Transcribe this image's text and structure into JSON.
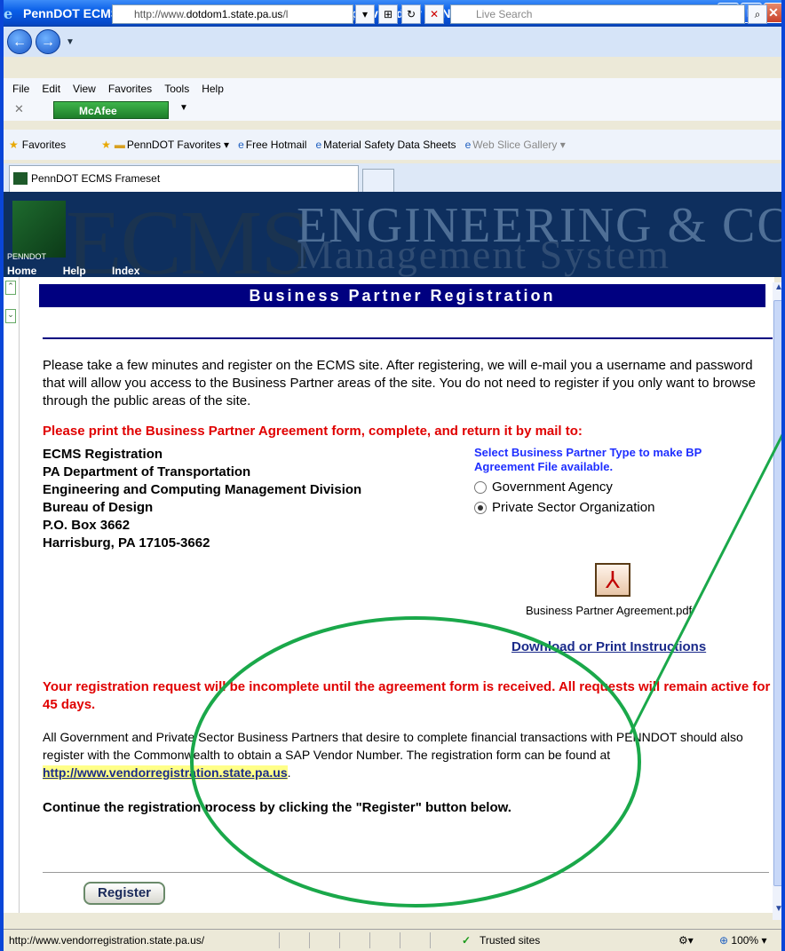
{
  "window": {
    "title": "PennDOT ECMS Frameset - Microsoft Internet Explorer provided by PENNDOT"
  },
  "address": {
    "url": "http://www.dotdom1.state.pa.us/l",
    "url_prefix": "http://www.",
    "url_host": "dotdom1.state.pa.us",
    "url_tail": "/l",
    "search_placeholder": "Live Search"
  },
  "menu": [
    "File",
    "Edit",
    "View",
    "Favorites",
    "Tools",
    "Help"
  ],
  "toolbar": {
    "mcafee": "McAfee"
  },
  "favorites": {
    "label": "Favorites",
    "items": [
      "PennDOT Favorites ▾",
      "Free Hotmail",
      "Material Safety Data Sheets",
      "Web Slice Gallery ▾"
    ]
  },
  "tab": {
    "title": "PennDOT ECMS Frameset"
  },
  "banner": {
    "logo_text": "ECMS",
    "line1": "ENGINEERING & CONSTRUC",
    "line2": "Management   System",
    "brand": "PENNDOT",
    "nav": [
      "Home",
      "Help",
      "Index"
    ]
  },
  "page": {
    "heading": "Business Partner Registration",
    "intro": "Please take a few minutes and register on the ECMS site. After registering, we will e-mail you a username and password that will allow you access to the Business Partner areas of the site. You do not need to register if you only want to browse through the public areas of the site.",
    "print_notice": "Please print the Business Partner Agreement form, complete, and return it by mail to:",
    "address_lines": [
      "ECMS Registration",
      "PA Department of Transportation",
      "Engineering and Computing Management Division",
      "Bureau of Design",
      "P.O. Box 3662",
      "Harrisburg, PA 17105-3662"
    ],
    "bp_select": "Select Business Partner Type to make BP Agreement File available.",
    "bp_options": [
      {
        "label": "Government Agency",
        "selected": false
      },
      {
        "label": "Private Sector Organization",
        "selected": true
      }
    ],
    "pdf_label": "Business Partner Agreement.pdf",
    "download_link": "Download or Print Instructions",
    "incomplete_notice": "Your registration request will be incomplete until the agreement form is received. All requests will remain active for 45 days.",
    "vendor_text": "All Government and Private Sector Business Partners that desire to complete financial transactions with PENNDOT should also register with the Commonwealth to obtain a SAP Vendor Number. The registration form can be found at ",
    "vendor_link": "http://www.vendorregistration.state.pa.us",
    "vendor_end": ".",
    "continue_text": "Continue the registration process by clicking the \"Register\" button below.",
    "register_button": "Register"
  },
  "status": {
    "url": "http://www.vendorregistration.state.pa.us/",
    "zone": "Trusted sites",
    "zoom": "100%"
  },
  "annotation_color": "#1aa84a"
}
